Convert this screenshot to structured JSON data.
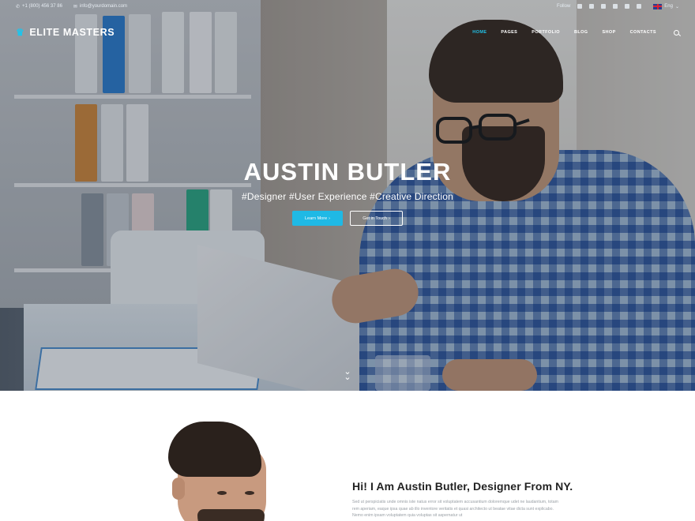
{
  "topbar": {
    "phone": "+1 (800) 456 37 86",
    "email": "info@yourdomain.com",
    "follow_label": "Follow",
    "social_icons": [
      "facebook-icon",
      "twitter-icon",
      "instagram-icon",
      "google-plus-icon",
      "pinterest-icon",
      "linkedin-icon"
    ],
    "language": "Eng"
  },
  "nav": {
    "logo": "ELITE MASTERS",
    "items": [
      "HOME",
      "PAGES",
      "PORTFOLIO",
      "BLOG",
      "SHOP",
      "CONTACTS"
    ],
    "active_item": "HOME"
  },
  "hero": {
    "title": "AUSTIN BUTLER",
    "tags": "#Designer  #User Experience  #Creative Direction",
    "primary_button": "Learn More",
    "secondary_button": "Get in Touch",
    "accent_color": "#1fb9e5"
  },
  "about": {
    "title": "Hi! I Am Austin Butler, Designer From NY.",
    "paragraph": "Sed ut perspiciatis unde omnis iste natus error sit voluptatem accusantium doloremque udet ne laudantium, totam rem aperiam, eaque ipsa quae ab illo inventore veritatis et quasi architecto ut beatae vitae dicta sunt explicabo. Nemo enim ipsam voluptatem quia voluptas sit aspernatur ut"
  }
}
